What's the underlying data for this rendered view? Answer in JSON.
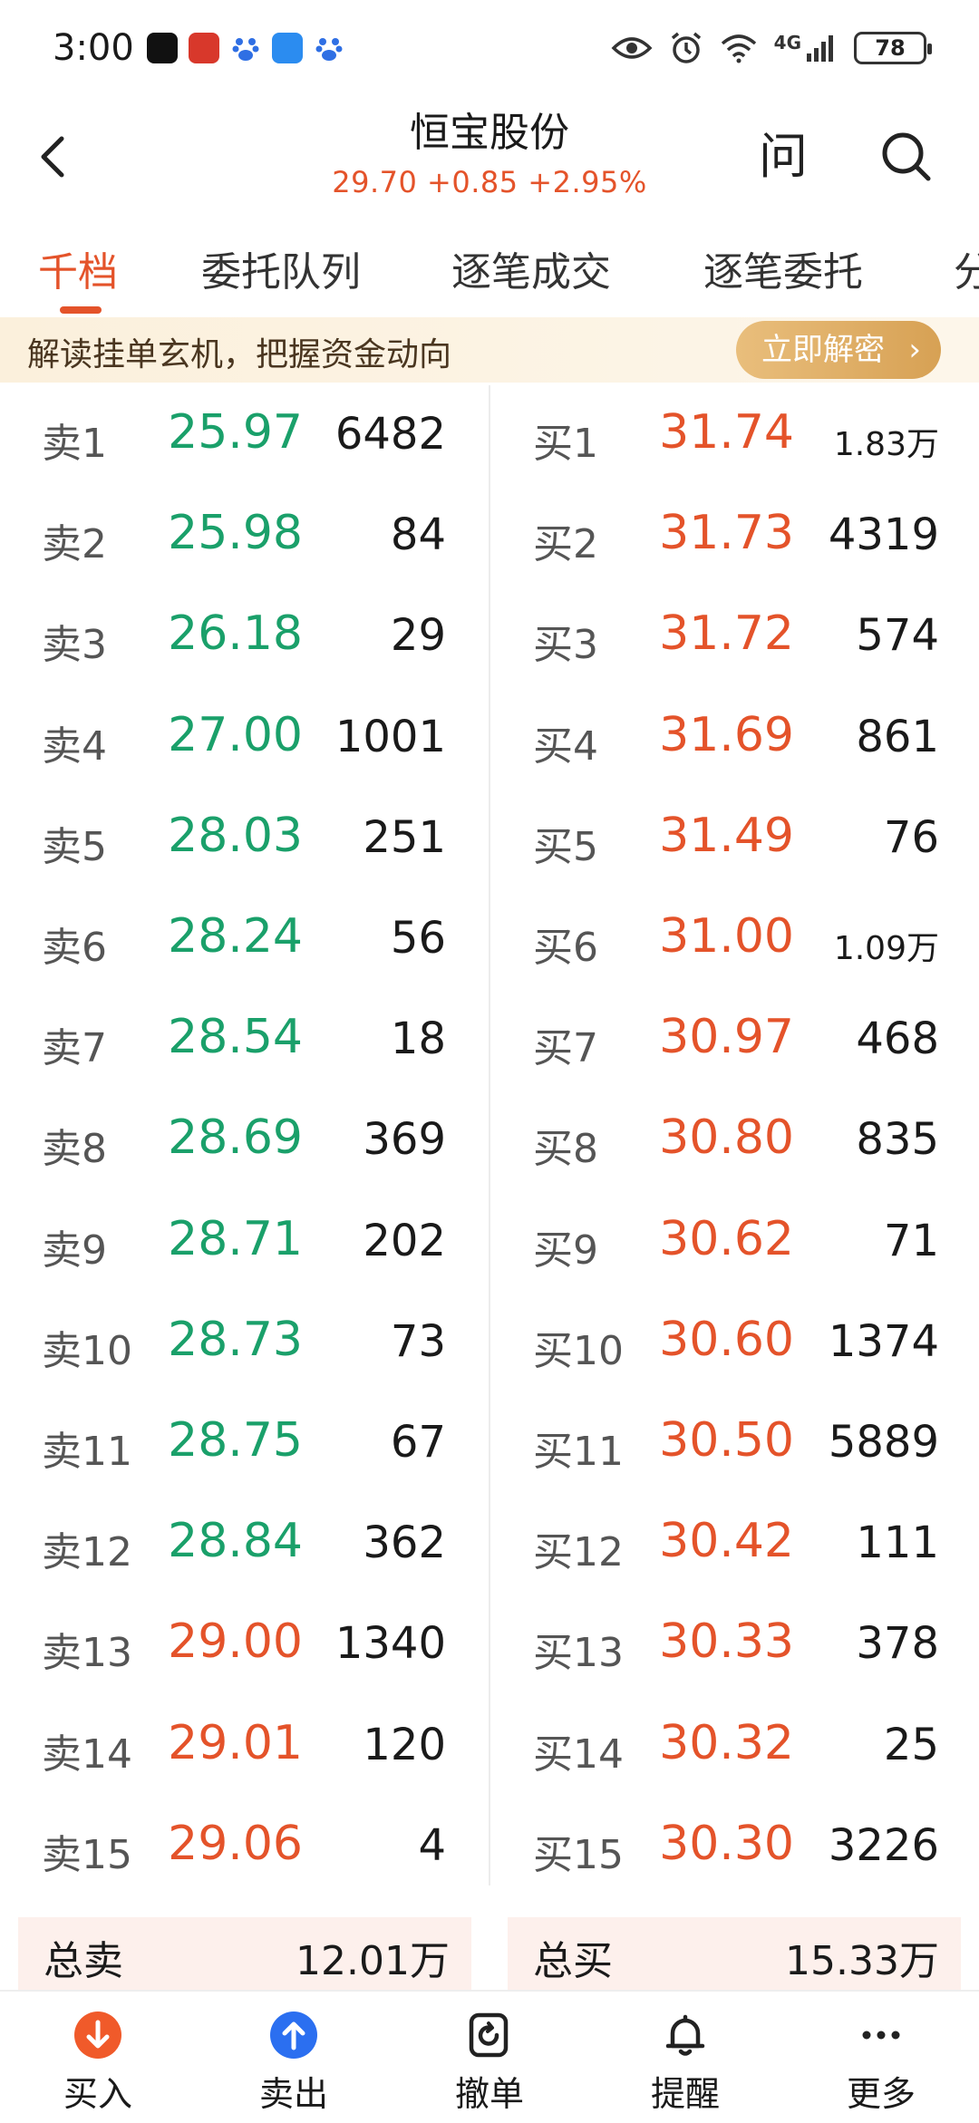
{
  "status_bar": {
    "time": "3:00",
    "network": "4G",
    "battery": "78"
  },
  "header": {
    "title": "恒宝股份",
    "quote": "29.70 +0.85 +2.95%",
    "ask_label": "问"
  },
  "tabs": [
    {
      "label": "千档"
    },
    {
      "label": "委托队列"
    },
    {
      "label": "逐笔成交"
    },
    {
      "label": "逐笔委托"
    },
    {
      "label": "分"
    }
  ],
  "banner": {
    "text": "解读挂单玄机，把握资金动向",
    "button": "立即解密",
    "chevron": "›"
  },
  "sell_orders": [
    {
      "label": "卖1",
      "price": "25.97",
      "volume": "6482",
      "color": "#1aa06a"
    },
    {
      "label": "卖2",
      "price": "25.98",
      "volume": "84",
      "color": "#1aa06a"
    },
    {
      "label": "卖3",
      "price": "26.18",
      "volume": "29",
      "color": "#1aa06a"
    },
    {
      "label": "卖4",
      "price": "27.00",
      "volume": "1001",
      "color": "#1aa06a"
    },
    {
      "label": "卖5",
      "price": "28.03",
      "volume": "251",
      "color": "#1aa06a"
    },
    {
      "label": "卖6",
      "price": "28.24",
      "volume": "56",
      "color": "#1aa06a"
    },
    {
      "label": "卖7",
      "price": "28.54",
      "volume": "18",
      "color": "#1aa06a"
    },
    {
      "label": "卖8",
      "price": "28.69",
      "volume": "369",
      "color": "#1aa06a"
    },
    {
      "label": "卖9",
      "price": "28.71",
      "volume": "202",
      "color": "#1aa06a"
    },
    {
      "label": "卖10",
      "price": "28.73",
      "volume": "73",
      "color": "#1aa06a"
    },
    {
      "label": "卖11",
      "price": "28.75",
      "volume": "67",
      "color": "#1aa06a"
    },
    {
      "label": "卖12",
      "price": "28.84",
      "volume": "362",
      "color": "#1aa06a"
    },
    {
      "label": "卖13",
      "price": "29.00",
      "volume": "1340",
      "color": "#e4532a"
    },
    {
      "label": "卖14",
      "price": "29.01",
      "volume": "120",
      "color": "#e4532a"
    },
    {
      "label": "卖15",
      "price": "29.06",
      "volume": "4",
      "color": "#e4532a"
    }
  ],
  "buy_orders": [
    {
      "label": "买1",
      "price": "31.74",
      "volume": "1.83万"
    },
    {
      "label": "买2",
      "price": "31.73",
      "volume": "4319"
    },
    {
      "label": "买3",
      "price": "31.72",
      "volume": "574"
    },
    {
      "label": "买4",
      "price": "31.69",
      "volume": "861"
    },
    {
      "label": "买5",
      "price": "31.49",
      "volume": "76"
    },
    {
      "label": "买6",
      "price": "31.00",
      "volume": "1.09万"
    },
    {
      "label": "买7",
      "price": "30.97",
      "volume": "468"
    },
    {
      "label": "买8",
      "price": "30.80",
      "volume": "835"
    },
    {
      "label": "买9",
      "price": "30.62",
      "volume": "71"
    },
    {
      "label": "买10",
      "price": "30.60",
      "volume": "1374"
    },
    {
      "label": "买11",
      "price": "30.50",
      "volume": "5889"
    },
    {
      "label": "买12",
      "price": "30.42",
      "volume": "111"
    },
    {
      "label": "买13",
      "price": "30.33",
      "volume": "378"
    },
    {
      "label": "买14",
      "price": "30.32",
      "volume": "25"
    },
    {
      "label": "买15",
      "price": "30.30",
      "volume": "3226"
    }
  ],
  "totals": {
    "sell_label": "总卖",
    "sell_value": "12.01万",
    "buy_label": "总买",
    "buy_value": "15.33万"
  },
  "bottom_bar": [
    {
      "label": "买入",
      "icon": "buy-arrow-down-icon"
    },
    {
      "label": "卖出",
      "icon": "sell-arrow-up-icon"
    },
    {
      "label": "撤单",
      "icon": "cancel-order-icon"
    },
    {
      "label": "提醒",
      "icon": "bell-icon"
    },
    {
      "label": "更多",
      "icon": "more-dots-icon"
    }
  ],
  "colors": {
    "up": "#e4532a",
    "down": "#1aa06a",
    "buy_btn": "#f05a2a",
    "sell_btn": "#2b6ff0"
  }
}
